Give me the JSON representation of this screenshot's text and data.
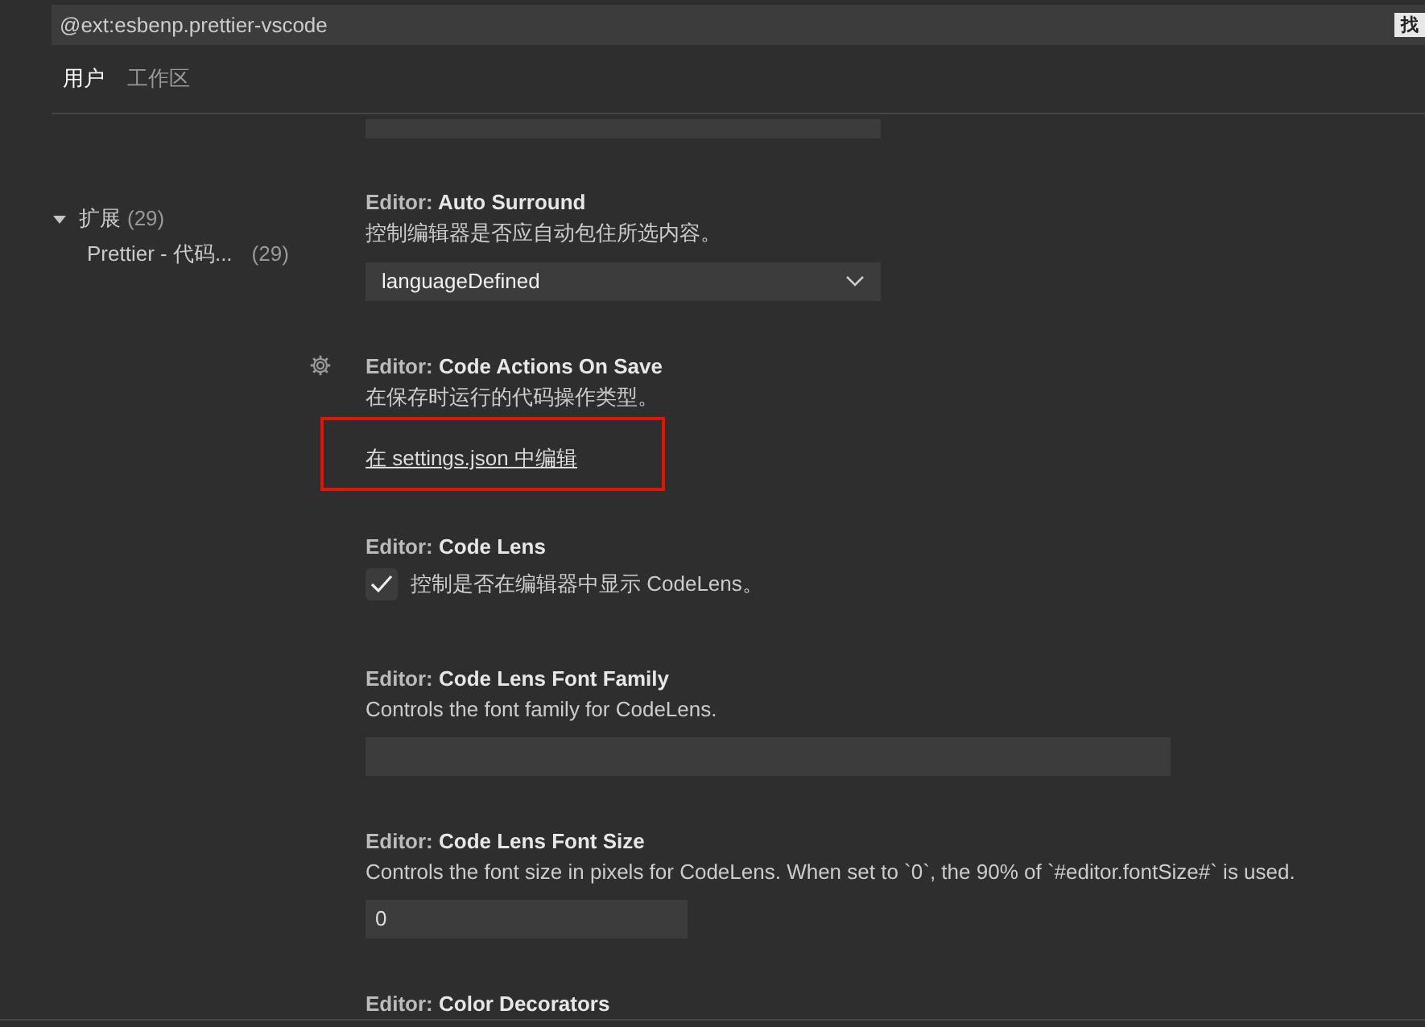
{
  "search": {
    "value": "@ext:esbenp.prettier-vscode",
    "badge": "找"
  },
  "tabs": [
    {
      "label": "用户",
      "selected": true
    },
    {
      "label": "工作区",
      "selected": false
    }
  ],
  "sidebar": {
    "items": [
      {
        "label": "扩展",
        "count": "(29)",
        "expanded": true,
        "children": [
          {
            "label": "Prettier - 代码...",
            "count": "(29)"
          }
        ]
      }
    ]
  },
  "settings": [
    {
      "kind": "cutoff"
    },
    {
      "kind": "select",
      "category": "Editor: ",
      "name": "Auto Surround",
      "description": "控制编辑器是否应自动包住所选内容。",
      "value": "languageDefined"
    },
    {
      "kind": "link",
      "category": "Editor: ",
      "name": "Code Actions On Save",
      "description": "在保存时运行的代码操作类型。",
      "link": "在 settings.json 中编辑",
      "gear": true,
      "highlighted": true
    },
    {
      "kind": "checkbox",
      "category": "Editor: ",
      "name": "Code Lens",
      "description": "控制是否在编辑器中显示 CodeLens。",
      "checked": true
    },
    {
      "kind": "text",
      "category": "Editor: ",
      "name": "Code Lens Font Family",
      "description": "Controls the font family for CodeLens."
    },
    {
      "kind": "number",
      "category": "Editor: ",
      "name": "Code Lens Font Size",
      "description": "Controls the font size in pixels for CodeLens. When set to `0`, the 90% of `#editor.fontSize#` is used.",
      "value": "0"
    },
    {
      "kind": "heading",
      "category": "Editor: ",
      "name": "Color Decorators"
    }
  ]
}
